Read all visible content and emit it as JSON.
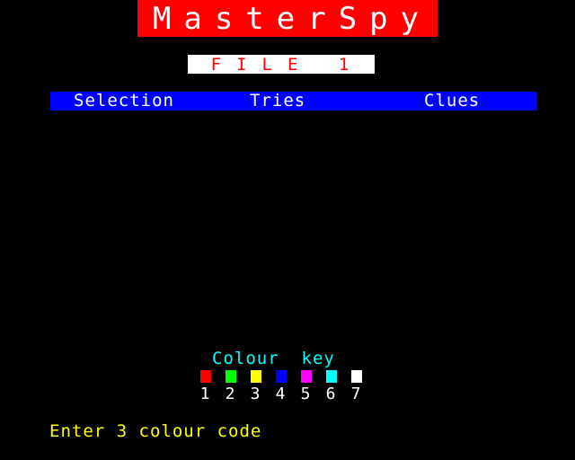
{
  "header": {
    "title": "MasterSpy",
    "file_label": "FILE 1"
  },
  "columns": {
    "selection": "Selection",
    "tries": "Tries",
    "clues": "Clues"
  },
  "colour_key": {
    "title": "Colour  key",
    "items": [
      {
        "number": "1",
        "color": "#ff0000"
      },
      {
        "number": "2",
        "color": "#00ff00"
      },
      {
        "number": "3",
        "color": "#ffff00"
      },
      {
        "number": "4",
        "color": "#0000ff"
      },
      {
        "number": "5",
        "color": "#ff00ff"
      },
      {
        "number": "6",
        "color": "#00ffff"
      },
      {
        "number": "7",
        "color": "#ffffff"
      }
    ]
  },
  "prompt": "Enter 3 colour code"
}
